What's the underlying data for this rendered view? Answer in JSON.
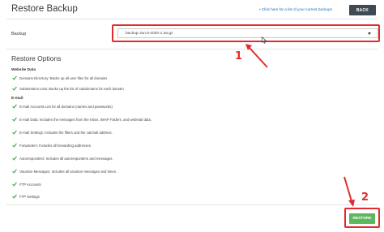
{
  "header": {
    "title": "Restore Backup",
    "link_text": "Click here for a list of your current backups",
    "back_label": "BACK"
  },
  "backup_field": {
    "label": "Backup",
    "selected_value": "backup-Jun.5-2020-1.tar.gz"
  },
  "restore_options": {
    "heading": "Restore Options",
    "sections": [
      {
        "title": "Website Data",
        "items": [
          "Domains Directory: Backs up all user files for all domains",
          "Subdomains Lists: Backs up the list of subdomains for each domain"
        ]
      },
      {
        "title": "E-mail",
        "items": [
          "E-mail Accounts List for all domains (names and passwords)",
          "E-mail Data: Includes the messages from the Inbox, IMAP Folders, and webmail data.",
          "E-mail Settings: Includes the filters and the catchall address.",
          "Forwarders: Includes all forwarding addresses.",
          "Autoresponders: Includes all autoresponders and messages.",
          "Vacation Messages: Includes all vacation messages and times.",
          "FTP Accounts",
          "FTP Settings"
        ]
      }
    ]
  },
  "footer": {
    "restore_label": "RESTORE"
  },
  "annotations": {
    "step_1": "1",
    "step_2": "2",
    "highlight_color": "#e02c2c"
  },
  "colors": {
    "back_button": "#3e4a54",
    "restore_button": "#5cb85c",
    "check": "#3fae49",
    "link": "#1a6bb5"
  }
}
